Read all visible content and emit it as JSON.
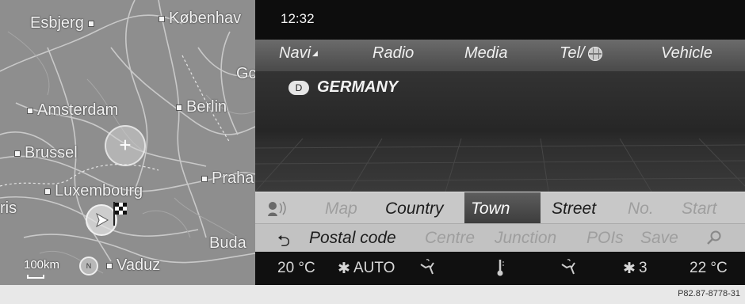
{
  "map": {
    "cities": [
      {
        "name": "Esbjerg",
        "square": "after"
      },
      {
        "name": "Københav",
        "square": "before"
      },
      {
        "name": "Gc",
        "square": "none"
      },
      {
        "name": "Amsterdam",
        "square": "before"
      },
      {
        "name": "Berlin",
        "square": "before"
      },
      {
        "name": "Brussel",
        "square": "before"
      },
      {
        "name": "Praha",
        "square": "before"
      },
      {
        "name": "Luxembourg",
        "square": "before"
      },
      {
        "name": "ris",
        "square": "none"
      },
      {
        "name": "Buda",
        "square": "none"
      },
      {
        "name": "Vaduz",
        "square": "before"
      }
    ],
    "scale": "100km",
    "zoom_symbol": "+",
    "compass_letter": "N"
  },
  "status": {
    "time": "12:32"
  },
  "main_menu": {
    "navi": "Navi",
    "radio": "Radio",
    "media": "Media",
    "tel": "Tel/",
    "vehicle": "Vehicle"
  },
  "destination": {
    "country_code": "D",
    "country_name": "GERMANY"
  },
  "input_menu_row1": {
    "map": "Map",
    "country": "Country",
    "town": "Town",
    "street": "Street",
    "no": "No.",
    "start": "Start",
    "selected": "Town"
  },
  "input_menu_row2": {
    "back_symbol": "⮌",
    "postal_code": "Postal code",
    "centre": "Centre",
    "junction": "Junction",
    "pois": "POIs",
    "save": "Save"
  },
  "climate": {
    "left_temp": "20 °C",
    "auto": "AUTO",
    "fan_level": "3",
    "right_temp": "22 °C"
  },
  "image_ref": "P82.87-8778-31"
}
